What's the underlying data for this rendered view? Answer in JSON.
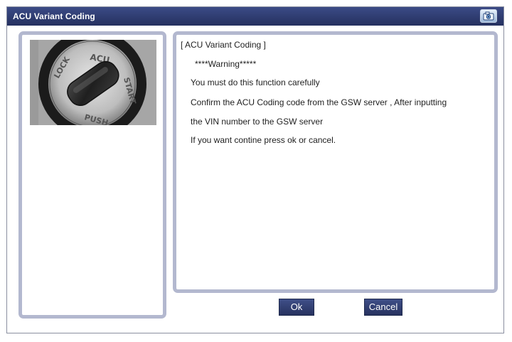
{
  "window": {
    "title": "ACU Variant Coding",
    "camera_icon": "camera-icon"
  },
  "side_panel": {
    "image": {
      "description_icon": "acu-dial-image",
      "dial_text_top": "ACU",
      "dial_text_left": "LOCK",
      "dial_text_right": "START",
      "dial_text_bottom": "PUSH"
    }
  },
  "message": {
    "lines": [
      "[ ACU Variant Coding ]",
      "****Warning*****",
      "You must do this function carefully",
      "Confirm the ACU Coding code from the GSW server , After inputting",
      "the VIN number to the GSW server",
      "If you want contine press ok or cancel."
    ]
  },
  "buttons": {
    "ok_label": "Ok",
    "cancel_label": "Cancel"
  },
  "colors": {
    "titlebar": "#2f3d73",
    "panel_border": "#b3b8cf",
    "button": "#34437a"
  }
}
